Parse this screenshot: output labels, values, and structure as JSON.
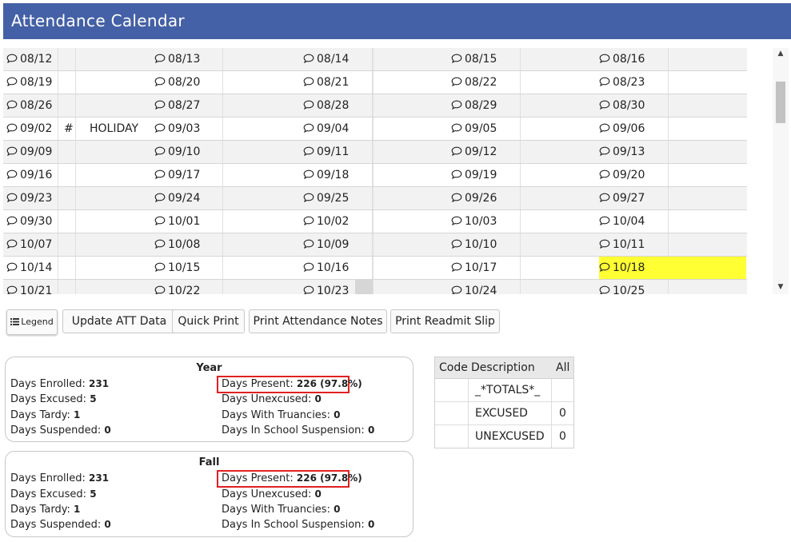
{
  "header": {
    "title": "Attendance Calendar"
  },
  "calendar": {
    "rows": [
      {
        "days": [
          "08/12",
          "08/13",
          "08/14",
          "08/15",
          "08/16"
        ],
        "mark": "",
        "note": ""
      },
      {
        "days": [
          "08/19",
          "08/20",
          "08/21",
          "08/22",
          "08/23"
        ],
        "mark": "",
        "note": ""
      },
      {
        "days": [
          "08/26",
          "08/27",
          "08/28",
          "08/29",
          "08/30"
        ],
        "mark": "",
        "note": ""
      },
      {
        "days": [
          "09/02",
          "09/03",
          "09/04",
          "09/05",
          "09/06"
        ],
        "mark": "#",
        "note": "HOLIDAY"
      },
      {
        "days": [
          "09/09",
          "09/10",
          "09/11",
          "09/12",
          "09/13"
        ],
        "mark": "",
        "note": ""
      },
      {
        "days": [
          "09/16",
          "09/17",
          "09/18",
          "09/19",
          "09/20"
        ],
        "mark": "",
        "note": ""
      },
      {
        "days": [
          "09/23",
          "09/24",
          "09/25",
          "09/26",
          "09/27"
        ],
        "mark": "",
        "note": ""
      },
      {
        "days": [
          "09/30",
          "10/01",
          "10/02",
          "10/03",
          "10/04"
        ],
        "mark": "",
        "note": ""
      },
      {
        "days": [
          "10/07",
          "10/08",
          "10/09",
          "10/10",
          "10/11"
        ],
        "mark": "",
        "note": ""
      },
      {
        "days": [
          "10/14",
          "10/15",
          "10/16",
          "10/17",
          "10/18"
        ],
        "mark": "",
        "note": ""
      },
      {
        "days": [
          "10/21",
          "10/22",
          "10/23",
          "10/24",
          "10/25"
        ],
        "mark": "",
        "note": ""
      }
    ],
    "highlight_color": "#ffff33"
  },
  "buttons": {
    "legend": "Legend",
    "update": "Update ATT Data",
    "quick_print": "Quick Print",
    "print_notes": "Print Attendance Notes",
    "print_readmit": "Print Readmit Slip"
  },
  "year": {
    "title": "Year",
    "enrolled_label": "Days Enrolled:",
    "enrolled": "231",
    "excused_label": "Days Excused:",
    "excused": "5",
    "tardy_label": "Days Tardy:",
    "tardy": "1",
    "suspended_label": "Days Suspended:",
    "suspended": "0",
    "present_label": "Days Present:",
    "present": "226 (97.8%)",
    "unexcused_label": "Days Unexcused:",
    "unexcused": "0",
    "truancies_label": "Days With Truancies:",
    "truancies": "0",
    "iss_label": "Days In School Suspension:",
    "iss": "0"
  },
  "fall": {
    "title": "Fall",
    "enrolled_label": "Days Enrolled:",
    "enrolled": "231",
    "excused_label": "Days Excused:",
    "excused": "5",
    "tardy_label": "Days Tardy:",
    "tardy": "1",
    "suspended_label": "Days Suspended:",
    "suspended": "0",
    "present_label": "Days Present:",
    "present": "226 (97.8%)",
    "unexcused_label": "Days Unexcused:",
    "unexcused": "0",
    "truancies_label": "Days With Truancies:",
    "truancies": "0",
    "iss_label": "Days In School Suspension:",
    "iss": "0"
  },
  "codes": {
    "headers": {
      "code": "Code",
      "description": "Description",
      "all": "All"
    },
    "rows": [
      {
        "code": "",
        "description": "_*TOTALS*_",
        "all": ""
      },
      {
        "code": "",
        "description": "EXCUSED",
        "all": "0"
      },
      {
        "code": "",
        "description": "UNEXCUSED",
        "all": "0"
      }
    ]
  }
}
